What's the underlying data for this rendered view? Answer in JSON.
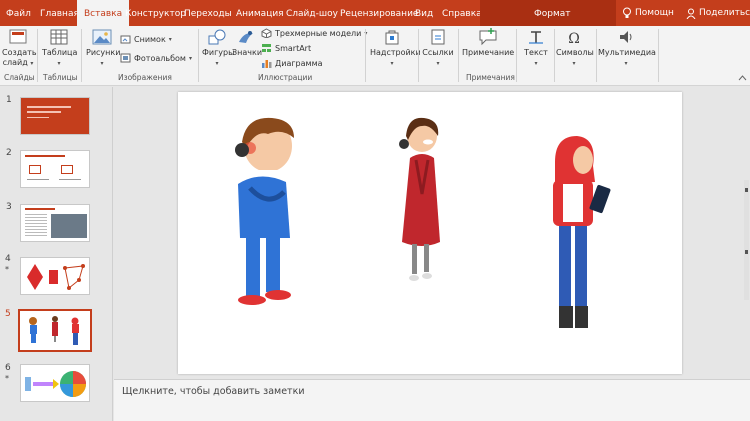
{
  "tabs": {
    "file": "Файл",
    "home": "Главная",
    "insert": "Вставка",
    "design": "Конструктор",
    "transitions": "Переходы",
    "animations": "Анимация",
    "slideshow": "Слайд-шоу",
    "review": "Рецензирование",
    "view": "Вид",
    "help": "Справка",
    "format": "Формат"
  },
  "titlebar": {
    "help_label": "Помощн",
    "share_label": "Поделиться"
  },
  "ribbon": {
    "slides": {
      "new_slide": "Создать",
      "new_slide_sub": "слайд",
      "label": "Слайды"
    },
    "tables": {
      "table": "Таблица",
      "label": "Таблицы"
    },
    "images": {
      "pictures": "Рисунки",
      "screenshot": "Снимок",
      "photo_album": "Фотоальбом",
      "label": "Изображения"
    },
    "illustrations": {
      "shapes": "Фигуры",
      "icons": "Значки",
      "models_3d": "Трехмерные модели",
      "smartart": "SmartArt",
      "chart": "Диаграмма",
      "label": "Иллюстрации"
    },
    "addins": {
      "addins": "Надстройки"
    },
    "links": {
      "links": "Ссылки"
    },
    "comments": {
      "comment": "Примечание",
      "label": "Примечания"
    },
    "text": {
      "text": "Текст"
    },
    "symbols": {
      "symbols": "Символы"
    },
    "media": {
      "media": "Мультимедиа"
    }
  },
  "thumbnails": [
    {
      "num": "1",
      "star": ""
    },
    {
      "num": "2",
      "star": ""
    },
    {
      "num": "3",
      "star": ""
    },
    {
      "num": "4",
      "star": "*"
    },
    {
      "num": "5",
      "star": ""
    },
    {
      "num": "6",
      "star": "*"
    }
  ],
  "selected_slide": 5,
  "notes": {
    "placeholder": "Щелкните, чтобы добавить заметки"
  },
  "colors": {
    "accent": "#c43e1c",
    "ribbon": "#f3f3f3",
    "workspace": "#e6e6e6"
  }
}
